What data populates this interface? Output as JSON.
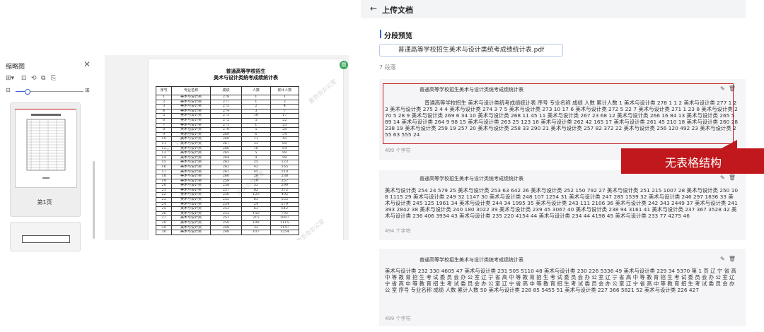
{
  "thumbnail_panel": {
    "title": "缩略图",
    "close_icon": "close-icon",
    "page_label": "第1页"
  },
  "viewer": {
    "title_line1": "普通高等学校招生",
    "title_line2": "美术与设计类统考成绩统计表",
    "columns": [
      "序号",
      "专业名称",
      "成绩",
      "人数",
      "累计人数"
    ],
    "rows": [
      [
        "1",
        "美术与设计类",
        "278",
        "1",
        "1"
      ],
      [
        "2",
        "美术与设计类",
        "277",
        "1",
        "2"
      ],
      [
        "3",
        "美术与设计类",
        "275",
        "2",
        "4"
      ],
      [
        "4",
        "美术与设计类",
        "274",
        "3",
        "7"
      ],
      [
        "5",
        "美术与设计类",
        "273",
        "10",
        "17"
      ],
      [
        "6",
        "美术与设计类",
        "272",
        "5",
        "22"
      ],
      [
        "7",
        "美术与设计类",
        "271",
        "1",
        "23"
      ],
      [
        "8",
        "美术与设计类",
        "270",
        "5",
        "28"
      ],
      [
        "9",
        "美术与设计类",
        "269",
        "6",
        "34"
      ],
      [
        "10",
        "美术与设计类",
        "268",
        "11",
        "45"
      ],
      [
        "11",
        "美术与设计类",
        "267",
        "23",
        "68"
      ],
      [
        "12",
        "美术与设计类",
        "266",
        "16",
        "84"
      ],
      [
        "13",
        "美术与设计类",
        "265",
        "5",
        "89"
      ],
      [
        "14",
        "美术与设计类",
        "264",
        "9",
        "98"
      ],
      [
        "15",
        "美术与设计类",
        "263",
        "25",
        "123"
      ],
      [
        "16",
        "美术与设计类",
        "262",
        "42",
        "165"
      ],
      [
        "17",
        "美术与设计类",
        "261",
        "45",
        "210"
      ],
      [
        "18",
        "美术与设计类",
        "260",
        "28",
        "238"
      ],
      [
        "19",
        "美术与设计类",
        "259",
        "19",
        "257"
      ],
      [
        "20",
        "美术与设计类",
        "258",
        "33",
        "290"
      ],
      [
        "21",
        "美术与设计类",
        "257",
        "82",
        "372"
      ],
      [
        "22",
        "美术与设计类",
        "256",
        "120",
        "492"
      ],
      [
        "23",
        "美术与设计类",
        "255",
        "63",
        "555"
      ],
      [
        "24",
        "美术与设计类",
        "254",
        "24",
        "579"
      ],
      [
        "25",
        "美术与设计类",
        "253",
        "63",
        "642"
      ],
      [
        "26",
        "美术与设计类",
        "252",
        "150",
        "792"
      ],
      [
        "27",
        "美术与设计类",
        "251",
        "215",
        "1007"
      ],
      [
        "28",
        "美术与设计类",
        "250",
        "108",
        "1115"
      ],
      [
        "29",
        "美术与设计类",
        "249",
        "32",
        "1147"
      ],
      [
        "30",
        "美术与设计类",
        "248",
        "107",
        "1254"
      ]
    ],
    "watermark": "委员会办公室",
    "badge": "鼎"
  },
  "right_panel": {
    "back_icon": "←",
    "title": "上传文档",
    "section_title": "分段预览",
    "file_name": "普通高等学校招生美术与设计类统考成绩统计表.pdf",
    "segment_count": "7 段落",
    "annotation": "无表格结构",
    "cards": [
      {
        "heading": "普通高等学校招生美术与设计类统考成绩统计表",
        "body": "普通高等学校招生 美术与设计类统考成绩统计表 序号 专业名称 成绩 人数 累计人数 1 美术与设计类 278 1 1 2 美术与设计类 277 1 2 3 美术与设计类 275 2 4 4 美术与设计类 274 3 7 5 美术与设计类 273 10 17 6 美术与设计类 272 5 22 7 美术与设计类 271 1 23 8 美术与设计类 270 5 28 9 美术与设计类 269 6 34 10 美术与设计类 268 11 45 11 美术与设计类 267 23 68 12 美术与设计类 266 16 84 13 美术与设计类 265 5 89 14 美术与设计类 264 9 98 15 美术与设计类 263 25 123 16 美术与设计类 262 42 165 17 美术与设计类 261 45 210 18 美术与设计类 260 28 238 19 美术与设计类 259 19 257 20 美术与设计类 258 33 290 21 美术与设计类 257 82 372 22 美术与设计类 256 120 492 23 美术与设计类 255 63 555 24",
        "chars": "499 个字符"
      },
      {
        "heading": "普通高等学校招生美术与设计类统考成绩统计表",
        "body": "美术与设计类 254 24 579 25 美术与设计类 253 63 642 26 美术与设计类 252 150 792 27 美术与设计类 251 215 1007 28 美术与设计类 250 108 1115 29 美术与设计类 249 32 1147 30 美术与设计类 248 107 1254 31 美术与设计类 247 285 1539 32 美术与设计类 246 297 1836 33 美术与设计类 245 125 1961 34 美术与设计类 244 34 1995 35 美术与设计类 243 111 2106 36 美术与设计类 242 343 2449 37 美术与设计类 241 393 2842 38 美术与设计类 240 180 3022 39 美术与设计类 239 45 3067 40 美术与设计类 238 94 3161 41 美术与设计类 237 367 3528 42 美术与设计类 236 406 3934 43 美术与设计类 235 220 4154 44 美术与设计类 234 44 4198 45 美术与设计类 233 77 4275 46",
        "chars": "494 个字符"
      },
      {
        "heading": "普通高等学校招生美术与设计类统考成绩统计表",
        "body": "美术与设计类 232 330 4605 47 美术与设计类 231 505 5110 48 美术与设计类 230 226 5336 49 美术与设计类 229 34 5370 第 1 页 辽 宁 省 高 中 等 教 育 招 生 考 试 委 员 会 办 公 室 辽 宁 省 高 中 等 教 育 招 生 考 试 委 员 会 办 公 室 辽 宁 省 高 中 等 教 育 招 生 考 试 委 员 会 办 公 室 辽 宁 省 高 中 等 教 育 招 生 考 试 委 员 会 办 公 室 辽 宁 省 高 中 等 教 育 招 生 考 试 委 员 会 办 公 室 辽 宁 省 高 中 等 教 育 招 生 考 试 委 员 会 办 公 室 序号 专业名称 成绩 人数 累计人数 50 美术与设计类 228 85 5455 51 美术与设计类 227 366 5821 52 美术与设计类 226 427",
        "chars": "499 个字符"
      }
    ]
  }
}
